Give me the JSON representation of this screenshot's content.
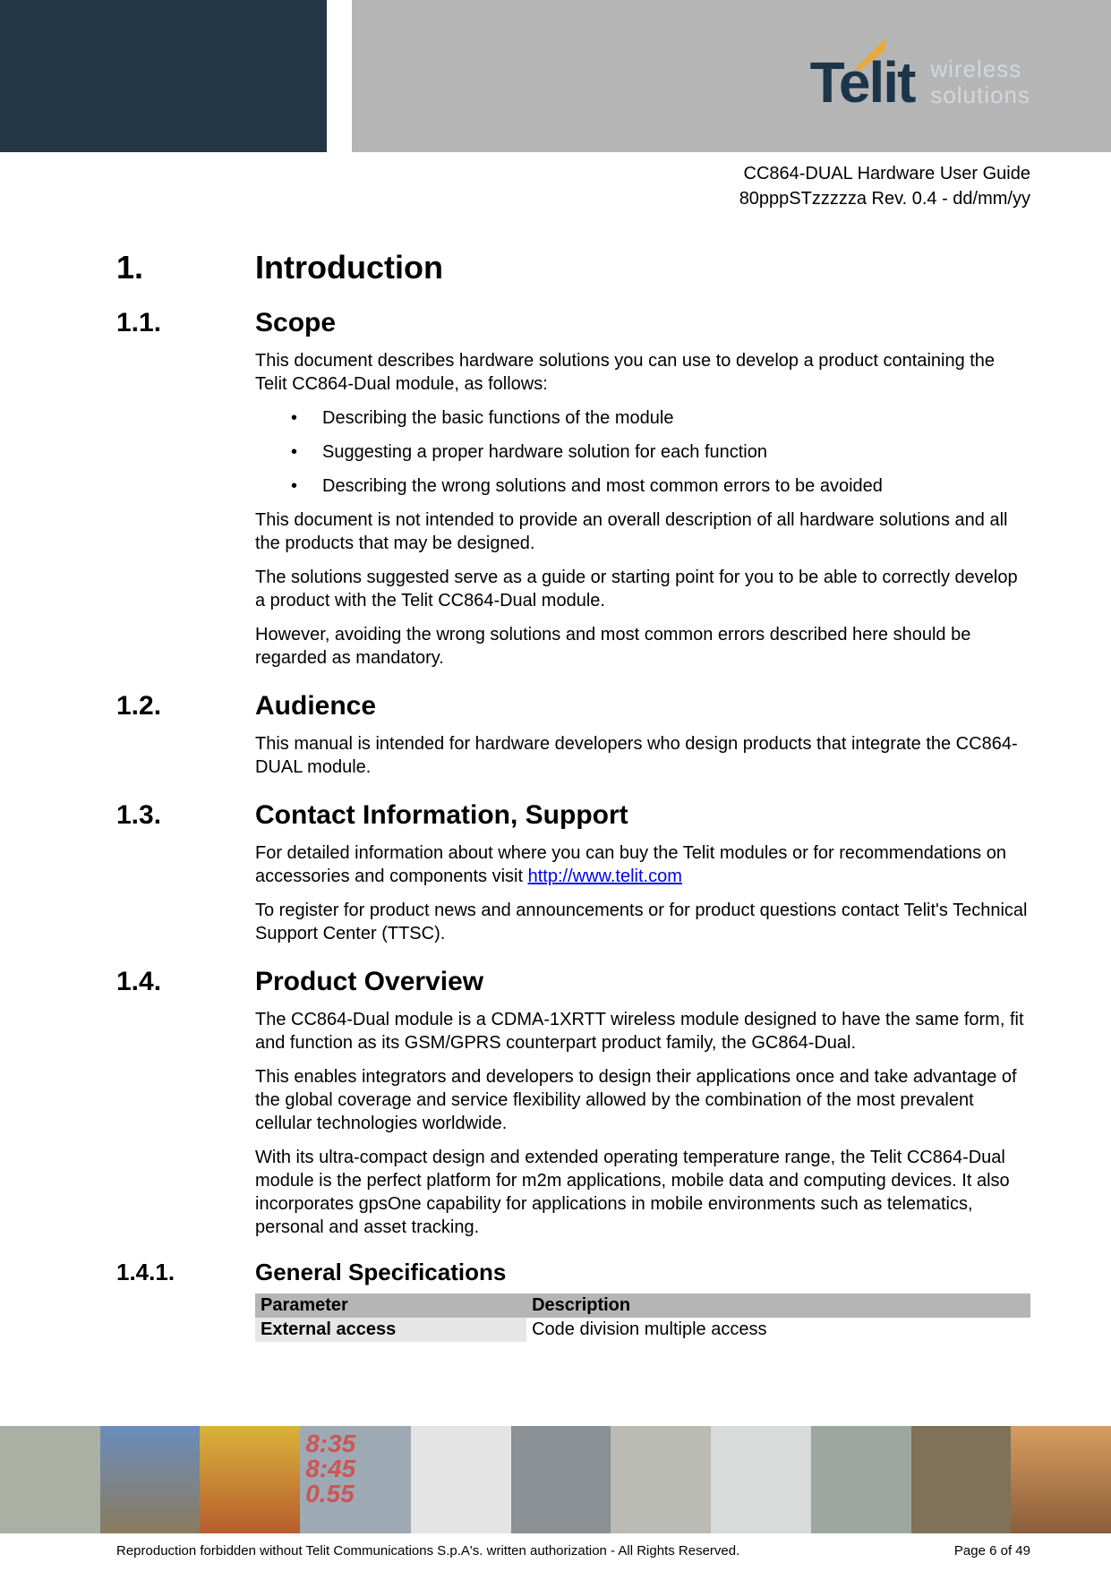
{
  "header": {
    "logo_text": "Telit",
    "logo_subtitle_line1": "wireless",
    "logo_subtitle_line2": "solutions",
    "doc_title": "CC864-DUAL Hardware User Guide",
    "doc_rev": "80pppSTzzzzza Rev. 0.4 - dd/mm/yy"
  },
  "sections": {
    "s1": {
      "num": "1.",
      "title": "Introduction"
    },
    "s1_1": {
      "num": "1.1.",
      "title": "Scope",
      "p1": "This document describes hardware solutions you can use to develop a product containing the Telit CC864-Dual module, as follows:",
      "bullets": [
        "Describing the basic functions of the module",
        "Suggesting a proper hardware solution for each function",
        "Describing the wrong solutions and most common errors to be avoided"
      ],
      "p2": "This document is not intended to provide an overall description of all hardware solutions and all the products that may be designed.",
      "p3": "The solutions suggested serve as a guide or starting point for you to be able to correctly develop a product with the Telit CC864-Dual module.",
      "p4": "However, avoiding the wrong solutions and most common errors described here should be regarded as mandatory."
    },
    "s1_2": {
      "num": "1.2.",
      "title": "Audience",
      "p1": "This manual is intended for hardware developers who design products that integrate the CC864-DUAL module."
    },
    "s1_3": {
      "num": "1.3.",
      "title": "Contact Information, Support",
      "p1_pre": "For detailed information about where you can buy the Telit modules or for recommendations on accessories and components visit ",
      "p1_link": "http://www.telit.com",
      "p2": "To register for product news and announcements or for product questions contact Telit's Technical Support Center (TTSC)."
    },
    "s1_4": {
      "num": "1.4.",
      "title": "Product Overview",
      "p1": "The CC864-Dual module is a CDMA-1XRTT wireless module designed to have the same form, fit and function as its GSM/GPRS counterpart product family, the GC864-Dual.",
      "p2": "This enables integrators and developers to design their applications once and take advantage of the global coverage and service flexibility allowed by the combination of the most prevalent cellular technologies worldwide.",
      "p3": "With its ultra-compact design and extended operating temperature range, the Telit CC864-Dual module is the perfect platform for m2m applications, mobile data and computing devices. It also incorporates gpsOne capability for applications in mobile environments such as telematics, personal and asset tracking."
    },
    "s1_4_1": {
      "num": "1.4.1.",
      "title": "General Specifications",
      "table": {
        "header": {
          "c1": "Parameter",
          "c2": "Description"
        },
        "row1": {
          "c1": "External access",
          "c2": "Code division multiple access"
        }
      }
    }
  },
  "footer": {
    "copyright": "Reproduction forbidden without Telit Communications S.p.A's. written authorization - All Rights Reserved.",
    "page": "Page 6 of 49",
    "clock_digits": "8:35\n8:45\n0.55"
  }
}
